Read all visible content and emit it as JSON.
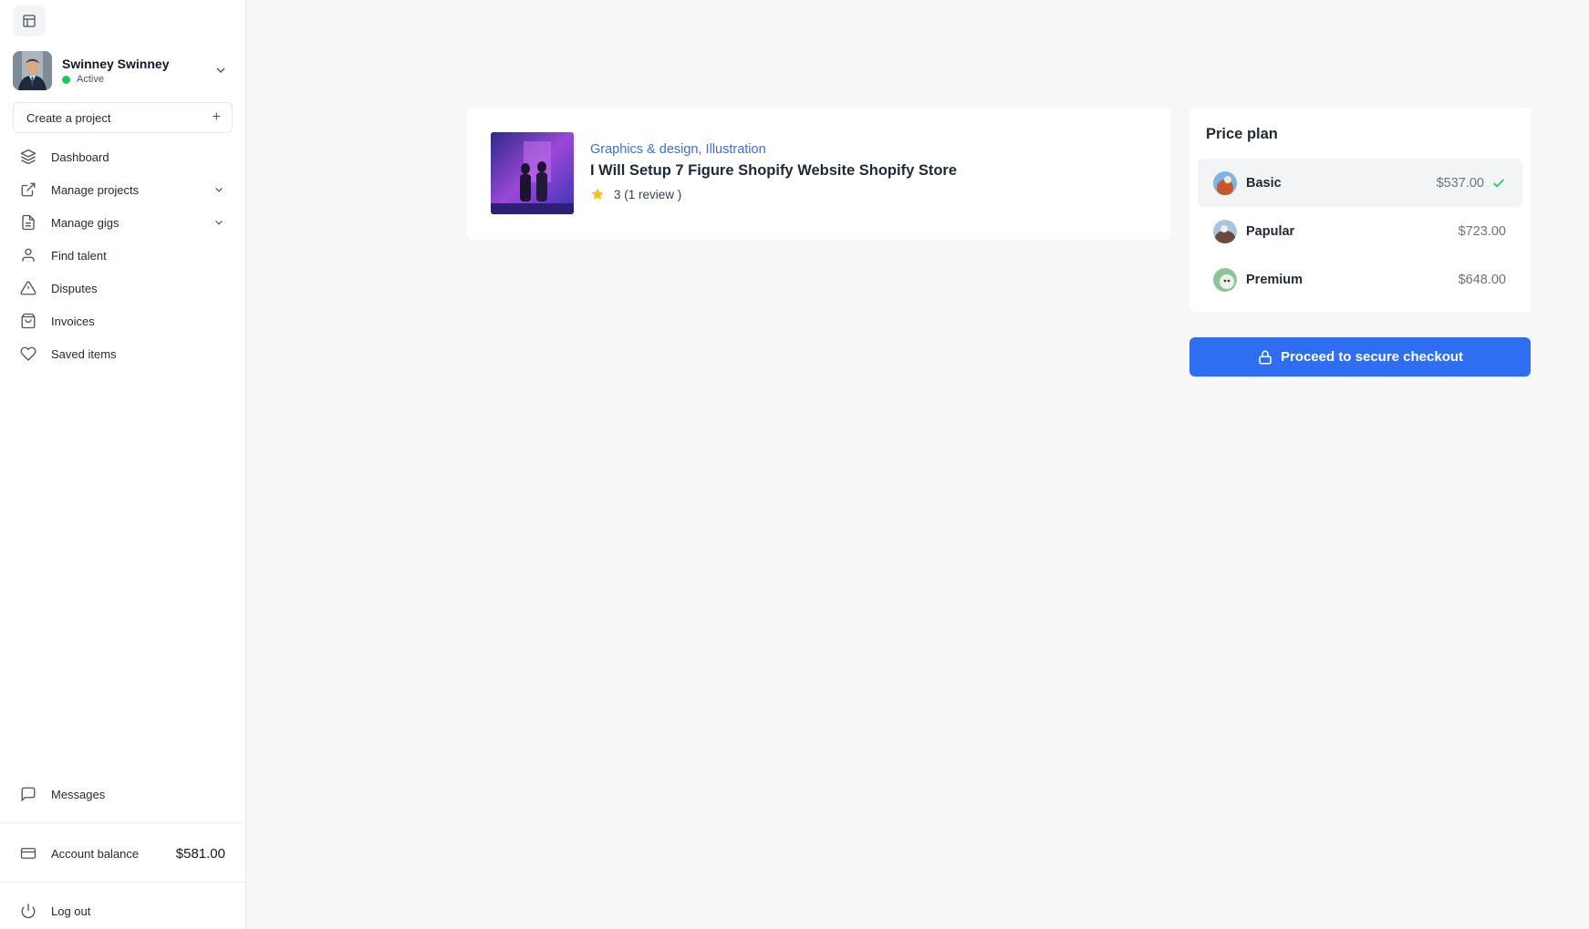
{
  "user": {
    "name": "Swinney Swinney",
    "status": "Active"
  },
  "sidebar": {
    "create_project": "Create a project",
    "items": [
      {
        "label": "Dashboard",
        "icon": "layers-icon"
      },
      {
        "label": "Manage projects",
        "icon": "external-link-icon",
        "expandable": true
      },
      {
        "label": "Manage gigs",
        "icon": "document-icon",
        "expandable": true
      },
      {
        "label": "Find talent",
        "icon": "user-icon"
      },
      {
        "label": "Disputes",
        "icon": "warning-icon"
      },
      {
        "label": "Invoices",
        "icon": "shopping-bag-icon"
      },
      {
        "label": "Saved items",
        "icon": "heart-icon"
      }
    ],
    "messages": "Messages",
    "account_balance_label": "Account balance",
    "account_balance_value": "$581.00",
    "logout": "Log out"
  },
  "gig": {
    "category_1": "Graphics & design",
    "category_separator": ",",
    "category_2": "Illustration",
    "title": "I Will Setup 7 Figure Shopify Website Shopify Store",
    "rating": "3",
    "reviews": "(1 review )"
  },
  "price_plan": {
    "title": "Price plan",
    "plans": [
      {
        "name": "Basic",
        "price": "$537.00",
        "selected": true
      },
      {
        "name": "Papular",
        "price": "$723.00",
        "selected": false
      },
      {
        "name": "Premium",
        "price": "$648.00",
        "selected": false
      }
    ]
  },
  "checkout": {
    "label": "Proceed to secure checkout"
  },
  "colors": {
    "accent": "#2f6ef0",
    "link": "#3b6fd8",
    "status_active": "#22c55e",
    "star": "#fbbf24"
  }
}
